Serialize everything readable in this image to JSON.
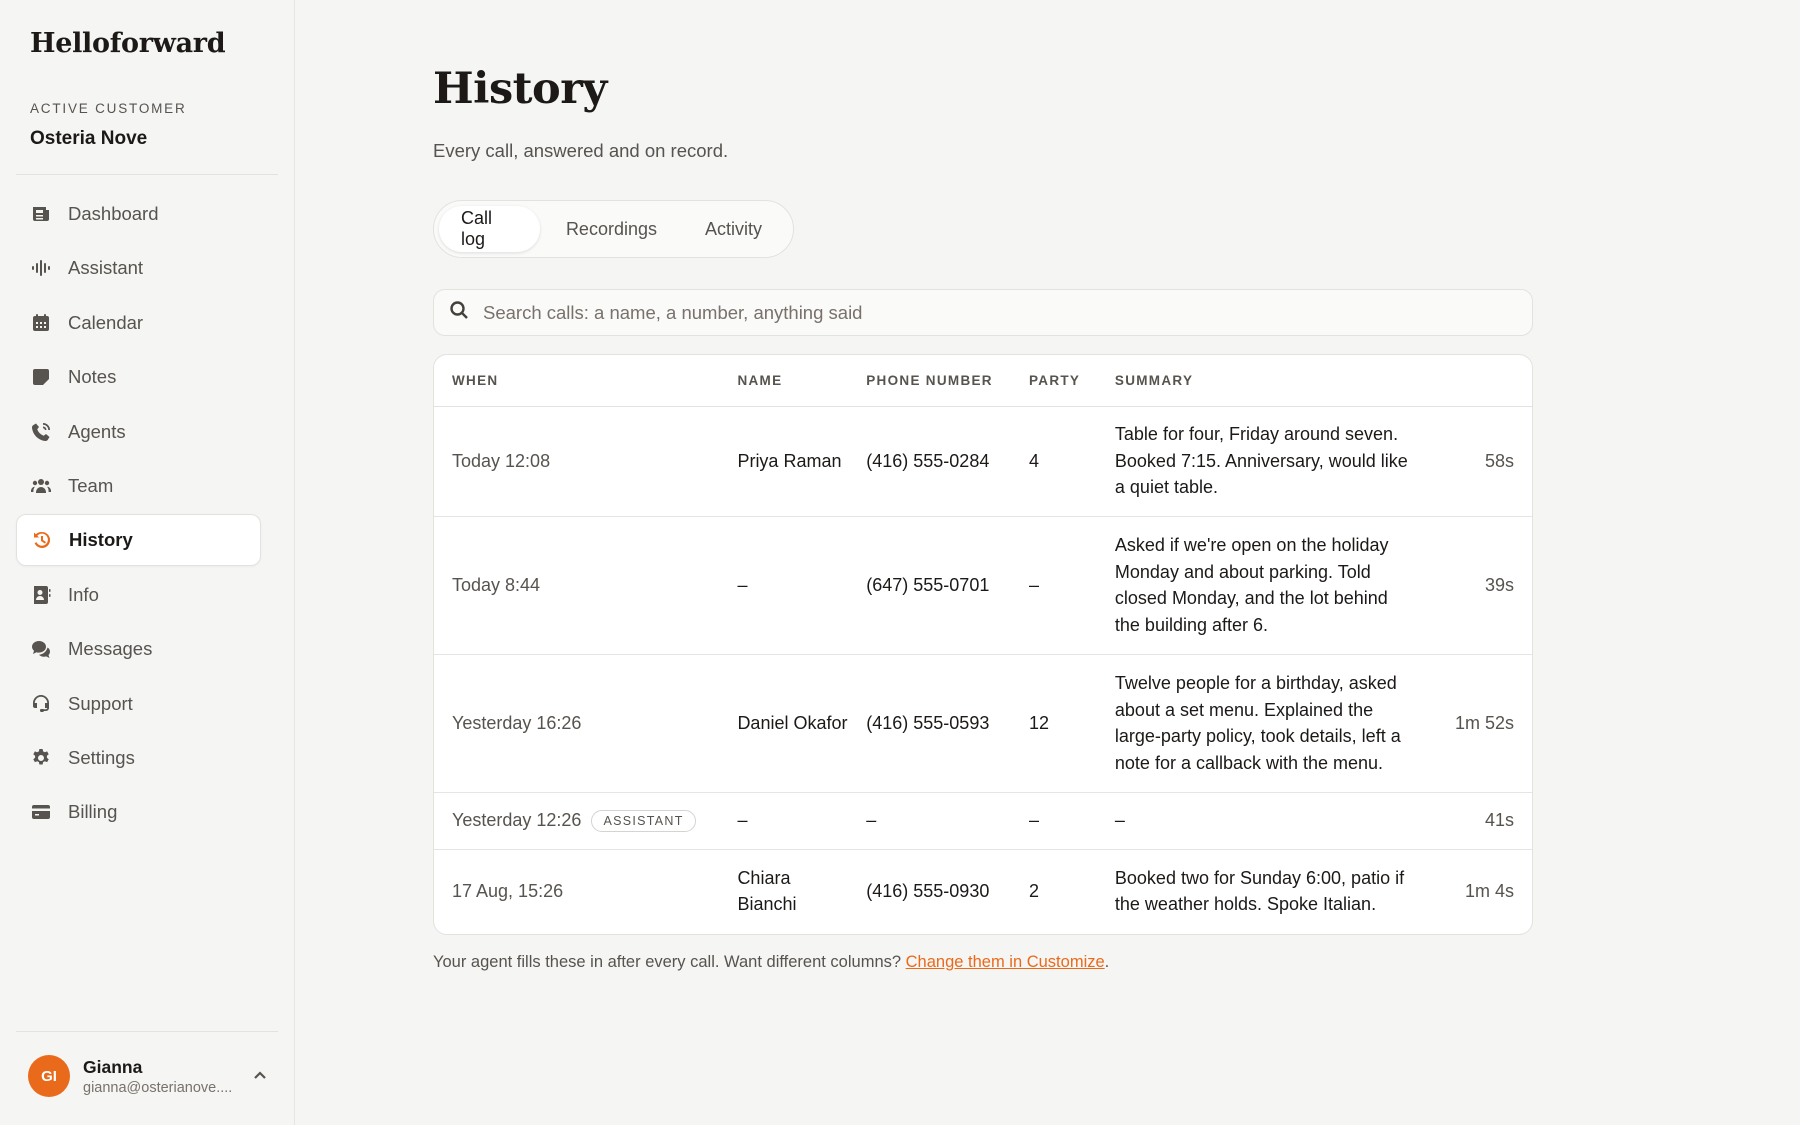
{
  "brand": "Helloforward",
  "customer": {
    "label": "ACTIVE CUSTOMER",
    "name": "Osteria Nove"
  },
  "nav": [
    {
      "label": "Dashboard",
      "icon": "dashboard-icon"
    },
    {
      "label": "Assistant",
      "icon": "waveform-icon"
    },
    {
      "label": "Calendar",
      "icon": "calendar-icon"
    },
    {
      "label": "Notes",
      "icon": "note-icon"
    },
    {
      "label": "Agents",
      "icon": "phone-icon"
    },
    {
      "label": "Team",
      "icon": "team-icon"
    },
    {
      "label": "History",
      "icon": "history-icon",
      "active": true
    },
    {
      "label": "Info",
      "icon": "contact-card-icon"
    },
    {
      "label": "Messages",
      "icon": "chat-bubbles-icon"
    },
    {
      "label": "Support",
      "icon": "headset-icon"
    },
    {
      "label": "Settings",
      "icon": "gear-icon"
    },
    {
      "label": "Billing",
      "icon": "credit-card-icon"
    }
  ],
  "user": {
    "initials": "GI",
    "name": "Gianna",
    "email": "gianna@osterianove...."
  },
  "page": {
    "title": "History",
    "subtitle": "Every call, answered and on record."
  },
  "tabs": [
    {
      "label": "Call log",
      "active": true
    },
    {
      "label": "Recordings"
    },
    {
      "label": "Activity"
    }
  ],
  "search": {
    "placeholder": "Search calls: a name, a number, anything said",
    "value": ""
  },
  "table": {
    "headers": [
      "WHEN",
      "NAME",
      "PHONE NUMBER",
      "PARTY",
      "SUMMARY",
      ""
    ],
    "rows": [
      {
        "when": "Today 12:08",
        "badge": "",
        "name": "Priya Raman",
        "phone": "(416) 555-0284",
        "party": "4",
        "summary": "Table for four, Friday around seven. Booked 7:15. Anniversary, would like a quiet table.",
        "duration": "58s"
      },
      {
        "when": "Today 8:44",
        "badge": "",
        "name": "–",
        "phone": "(647) 555-0701",
        "party": "–",
        "summary": "Asked if we're open on the holiday Monday and about parking. Told closed Monday, and the lot behind the building after 6.",
        "duration": "39s"
      },
      {
        "when": "Yesterday 16:26",
        "badge": "",
        "name": "Daniel Okafor",
        "phone": "(416) 555-0593",
        "party": "12",
        "summary": "Twelve people for a birthday, asked about a set menu. Explained the large-party policy, took details, left a note for a callback with the menu.",
        "duration": "1m 52s"
      },
      {
        "when": "Yesterday 12:26",
        "badge": "ASSISTANT",
        "name": "–",
        "phone": "–",
        "party": "–",
        "summary": "–",
        "duration": "41s"
      },
      {
        "when": "17 Aug, 15:26",
        "badge": "",
        "name": "Chiara Bianchi",
        "phone": "(416) 555-0930",
        "party": "2",
        "summary": "Booked two for Sunday 6:00, patio if the weather holds. Spoke Italian.",
        "duration": "1m 4s"
      }
    ]
  },
  "footnote": {
    "text": "Your agent fills these in after every call. Want different columns? ",
    "link": "Change them in Customize",
    "end": "."
  },
  "colors": {
    "accent": "#ea6a1b",
    "background": "#f5f5f4",
    "card": "#ffffff"
  }
}
